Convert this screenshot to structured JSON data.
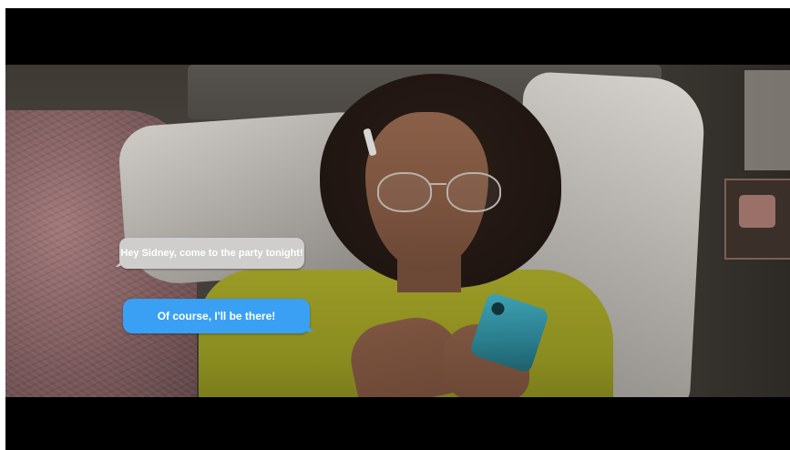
{
  "messages": {
    "received": "Hey Sidney, come to the party tonight!",
    "sent": "Of course, I'll be there!"
  },
  "colors": {
    "received_bubble": "#cfcecc",
    "sent_bubble": "#3aa0f3",
    "letterbox": "#000000"
  }
}
